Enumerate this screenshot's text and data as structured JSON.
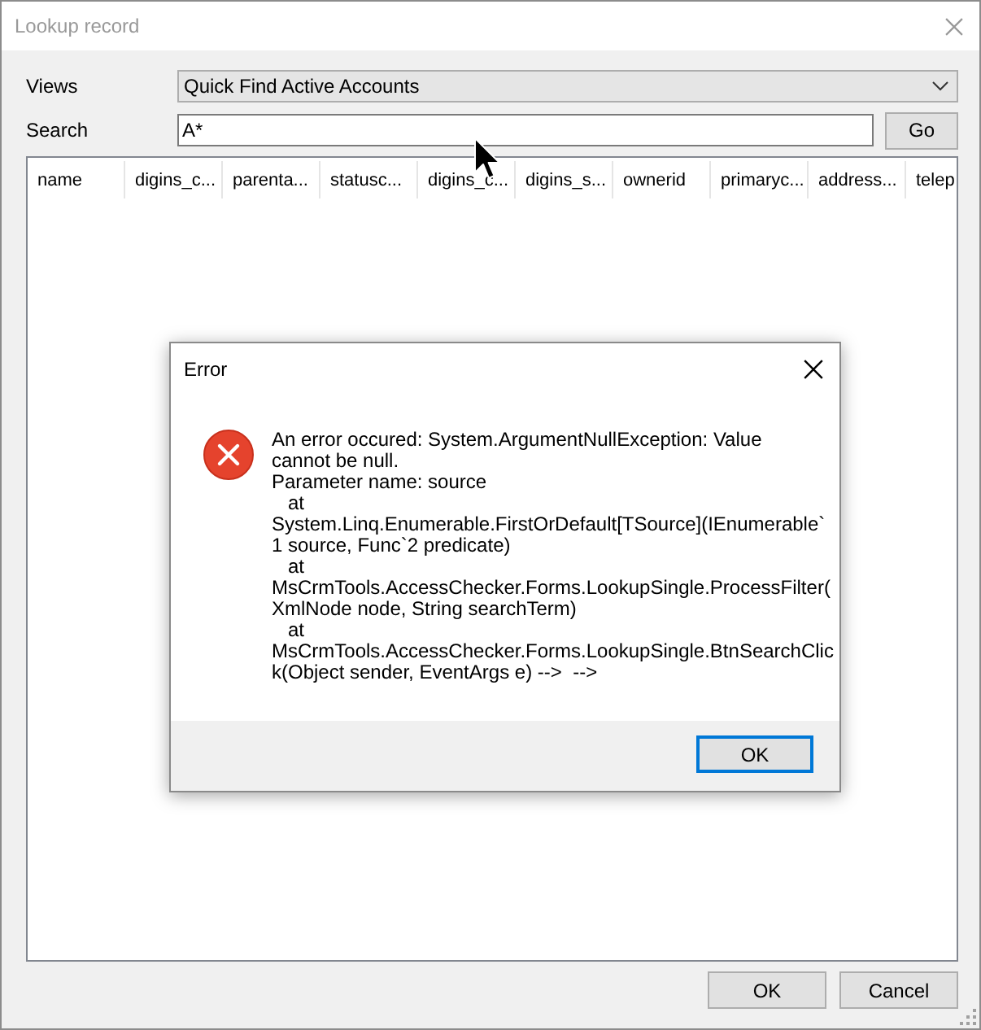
{
  "window": {
    "title": "Lookup record",
    "active": false
  },
  "views": {
    "label": "Views",
    "value": "Quick Find Active Accounts"
  },
  "search": {
    "label": "Search",
    "value": "A*",
    "button": "Go"
  },
  "results": {
    "columns": [
      "name",
      "digins_c...",
      "parenta...",
      "statusc...",
      "digins_c...",
      "digins_s...",
      "ownerid",
      "primaryc...",
      "address...",
      "telep"
    ]
  },
  "buttons": [
    "OK",
    "Cancel"
  ],
  "error_dialog": {
    "title": "Error",
    "message_lines": [
      "An error occured: System.ArgumentNullException: Value",
      "cannot be null.",
      "Parameter name: source",
      "   at",
      "System.Linq.Enumerable.FirstOrDefault[TSource](IEnumerable`",
      "1 source, Func`2 predicate)",
      "   at",
      "MsCrmTools.AccessChecker.Forms.LookupSingle.ProcessFilter(",
      "XmlNode node, String searchTerm)",
      "   at",
      "MsCrmTools.AccessChecker.Forms.LookupSingle.BtnSearchClic",
      "k(Object sender, EventArgs e) -->  -->"
    ],
    "button": {
      "label": "OK",
      "focused": true
    }
  }
}
